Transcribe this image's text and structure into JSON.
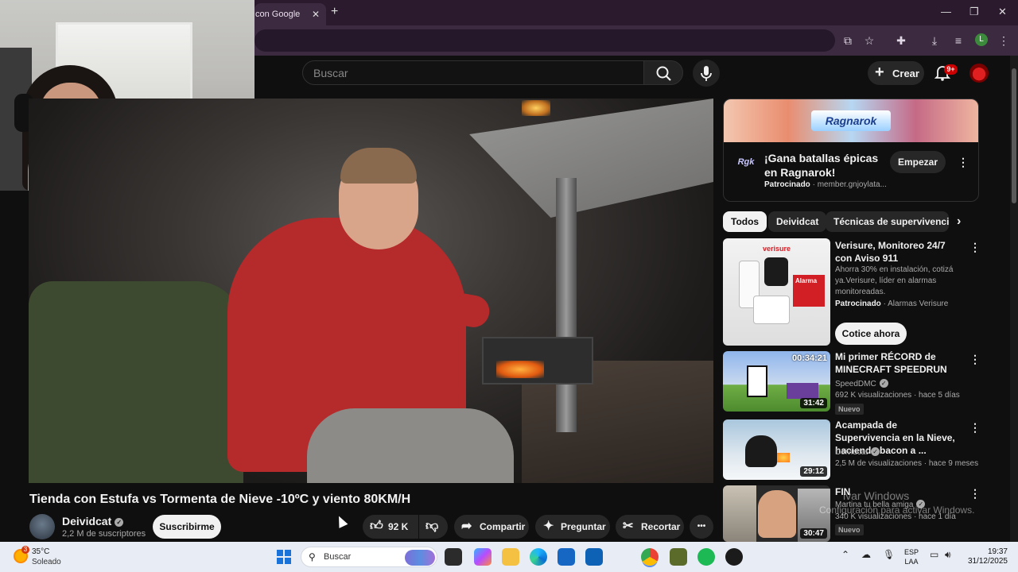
{
  "browser": {
    "tab_title": "con Google",
    "tab_close": "✕",
    "new_tab": "+",
    "window_controls": [
      "—",
      "❐",
      "✕"
    ],
    "profile_initial": "L"
  },
  "masthead": {
    "search_placeholder": "Buscar",
    "create_label": "Crear",
    "notifications_badge": "9+"
  },
  "video": {
    "title": "Tienda con Estufa vs Tormenta de Nieve -10ºC y viento 80KM/H",
    "channel": "Deividcat",
    "subscribers": "2,2 M de suscriptores",
    "subscribe_label": "Suscribirme",
    "likes": "92 K",
    "share_label": "Compartir",
    "ask_label": "Preguntar",
    "clip_label": "Recortar",
    "more_label": "•••"
  },
  "ad": {
    "banner_logo": "Ragnarok",
    "advertiser_logo": "Rgk",
    "title": "¡Gana batallas épicas en Ragnarok!",
    "sponsored": "Patrocinado",
    "domain": "member.gnjoylata...",
    "button": "Empezar"
  },
  "chips": [
    "Todos",
    "Deividcat",
    "Técnicas de supervivencia"
  ],
  "recommendations": [
    {
      "title": "Verisure, Monitoreo 24/7 con Aviso 911",
      "description": "Ahorra 30% en instalación, cotizá ya.Verisure, líder en alarmas monitoreadas.",
      "sponsored": "Patrocinado",
      "advertiser": "Alarmas Verisure",
      "cta": "Cotice ahora",
      "thumb_label": "verisure",
      "thumb_tag": "Alarma"
    },
    {
      "title": "Mi primer RÉCORD de MINECRAFT SPEEDRUN",
      "channel": "SpeedDMC",
      "meta": "692 K visualizaciones · hace 5 días",
      "badge": "Nuevo",
      "duration": "31:42",
      "overlay": "00:34:21"
    },
    {
      "title": "Acampada de Supervivencia en la Nieve, haciendo bacon a ...",
      "channel": "Deividcat",
      "meta": "2,5 M de visualizaciones · hace 9 meses",
      "duration": "29:12"
    },
    {
      "title": "FIN",
      "channel": "Martina tu bella amiga",
      "meta": "340 K visualizaciones · hace 1 día",
      "badge": "Nuevo",
      "duration": "30:47"
    }
  ],
  "activation_watermark": {
    "line1": "ivar Windows",
    "line2": "Configuración para activar Windows."
  },
  "taskbar": {
    "weather_badge": "3",
    "temperature": "35°C",
    "condition": "Soleado",
    "search_label": "Buscar",
    "language_line1": "ESP",
    "language_line2": "LAA",
    "time": "19:37",
    "date": "31/12/2025"
  }
}
